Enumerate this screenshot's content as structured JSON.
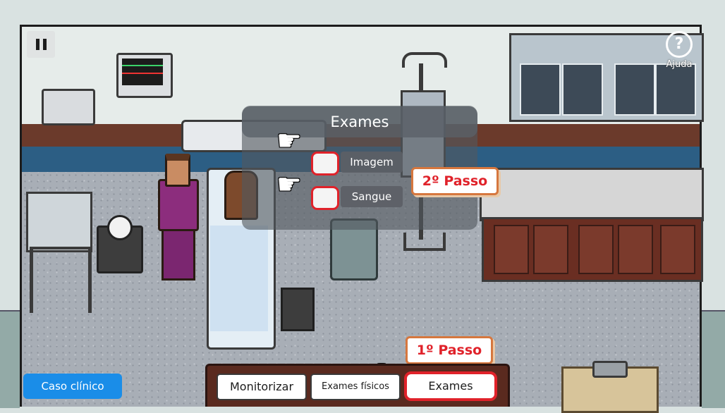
{
  "hud": {
    "pause_icon": "pause-icon",
    "help_glyph": "?",
    "help_label": "Ajuda",
    "case_button": "Caso clínico"
  },
  "exams_panel": {
    "title": "Exames",
    "options": [
      {
        "label": "Imagem"
      },
      {
        "label": "Sangue"
      }
    ]
  },
  "steps": {
    "step1": "1º Passo",
    "step2": "2º Passo"
  },
  "actions": {
    "monitorizar": "Monitorizar",
    "exames_fisicos": "Exames físicos",
    "exames": "Exames"
  },
  "colors": {
    "highlight": "#e0222a",
    "tag_border": "#d6773e",
    "case_button": "#1a8de8",
    "action_bar": "#5a2a1f"
  }
}
